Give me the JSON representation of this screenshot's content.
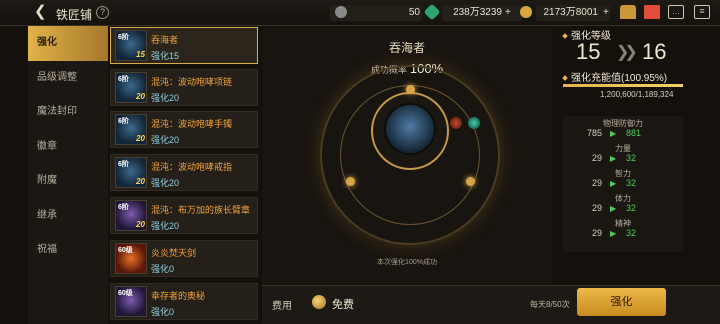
{
  "header": {
    "title": "铁匠铺",
    "help": "?",
    "currencies": [
      {
        "icon": "energy-icon",
        "value": "50"
      },
      {
        "icon": "green-gem-icon",
        "value": "238万3239"
      },
      {
        "icon": "gold-coin-icon",
        "value": "2173万8001"
      }
    ],
    "plus": "+"
  },
  "sidebar": {
    "items": [
      {
        "label": "强化",
        "active": true
      },
      {
        "label": "品级调整"
      },
      {
        "label": "魔法封印"
      },
      {
        "label": "徽章"
      },
      {
        "label": "附魔"
      },
      {
        "label": "继承"
      },
      {
        "label": "祝福"
      }
    ]
  },
  "items": [
    {
      "name": "吞海者",
      "level_tag": "6阶",
      "badge": "15",
      "enhance": "强化15",
      "selected": true
    },
    {
      "name": "混沌：波动咆哮项链",
      "level_tag": "6阶",
      "badge": "20",
      "enhance": "强化20"
    },
    {
      "name": "混沌：波动咆哮手镯",
      "level_tag": "6阶",
      "badge": "20",
      "enhance": "强化20"
    },
    {
      "name": "混沌：波动咆哮戒指",
      "level_tag": "6阶",
      "badge": "20",
      "enhance": "强化20"
    },
    {
      "name": "混沌：布万加的族长臂章",
      "level_tag": "6阶",
      "badge": "20",
      "enhance": "强化20"
    },
    {
      "name": "炎炎焚天剑",
      "level_tag": "60级",
      "badge": "",
      "enhance": "强化0"
    },
    {
      "name": "幸存者的奥秘",
      "level_tag": "60级",
      "badge": "",
      "enhance": "强化0"
    }
  ],
  "center": {
    "item_name": "吞海者",
    "prob_label": "成功概率",
    "prob_value": "100%",
    "hint": "本次强化100%成功"
  },
  "bottom": {
    "fee_label": "费用",
    "fee_value": "免费",
    "daily": "每天8/50次",
    "button": "强化"
  },
  "right": {
    "level_label": "强化等级",
    "level_from": "15",
    "level_to": "16",
    "arrow": "❯❯",
    "energy_label": "强化充能值(100.95%)",
    "energy_fraction": 1.0,
    "energy_text": "1,200,600/1,189,324",
    "stats": [
      {
        "name": "物理防御力",
        "old": "785",
        "new": "881"
      },
      {
        "name": "力量",
        "old": "29",
        "new": "32"
      },
      {
        "name": "智力",
        "old": "29",
        "new": "32"
      },
      {
        "name": "体力",
        "old": "29",
        "new": "32"
      },
      {
        "name": "精神",
        "old": "29",
        "new": "32"
      }
    ],
    "stat_arrow": "▶"
  },
  "colors": {
    "accent": "#e0b04a",
    "increase": "#4fcb5a",
    "enhance_text": "#8fd3e6",
    "item_name": "#f0a33a"
  }
}
